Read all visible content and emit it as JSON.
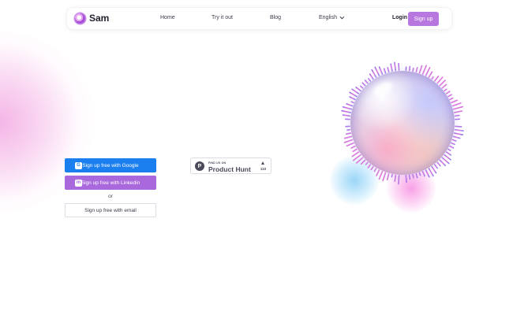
{
  "nav": {
    "brand": "Sam",
    "links": [
      "Home",
      "Try it out",
      "Blog"
    ],
    "language": "English",
    "login": "Login",
    "signup": "Sign up"
  },
  "auth": {
    "google": "Sign up free with Google",
    "linkedin": "Sign up free with Linkedin",
    "or": "or",
    "email": "Sign up free with email"
  },
  "product_hunt": {
    "small": "FIND US ON",
    "name": "Product Hunt",
    "upvotes": "110"
  },
  "colors": {
    "accent": "#b777df",
    "google": "#1b7ff0",
    "linkedin": "#a969dc"
  },
  "icons": [
    "logo-icon",
    "chevron-down-icon",
    "google-icon",
    "linkedin-icon",
    "product-hunt-icon",
    "upvote-arrow-icon"
  ]
}
